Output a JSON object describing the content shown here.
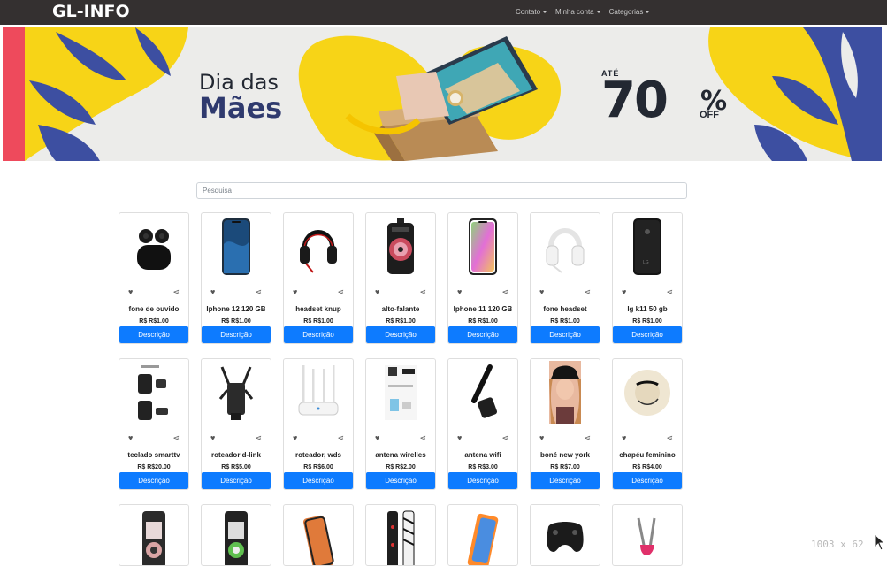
{
  "navbar": {
    "brand": "GL-INFO",
    "menu": [
      {
        "label": "Contato"
      },
      {
        "label": "Minha conta"
      },
      {
        "label": "Categorias"
      }
    ]
  },
  "banner": {
    "title_line1": "Dia das",
    "title_line2": "Mães",
    "ate": "ATÉ",
    "percent": "70",
    "percent_sign": "%",
    "off": "OFF",
    "colors": {
      "yellow": "#f7d417",
      "blue": "#3d4fa1",
      "stripe": "#ee4a5c"
    }
  },
  "search": {
    "placeholder": "Pesquisa",
    "value": ""
  },
  "products": [
    {
      "name": "fone de ouvido",
      "price": "R$ R$1.00",
      "button": "Descrição",
      "icon": "earbuds-icon"
    },
    {
      "name": "Iphone 12 120 GB",
      "price": "R$ R$1.00",
      "button": "Descrição",
      "icon": "iphone-12-icon"
    },
    {
      "name": "headset knup",
      "price": "R$ R$1.00",
      "button": "Descrição",
      "icon": "headset-knup-icon"
    },
    {
      "name": "alto-falante",
      "price": "R$ R$1.00",
      "button": "Descrição",
      "icon": "speaker-icon"
    },
    {
      "name": "Iphone 11 120 GB",
      "price": "R$ R$1.00",
      "button": "Descrição",
      "icon": "iphone-11-icon"
    },
    {
      "name": "fone headset",
      "price": "R$ R$1.00",
      "button": "Descrição",
      "icon": "white-headset-icon"
    },
    {
      "name": "lg k11 50 gb",
      "price": "R$ R$1.00",
      "button": "Descrição",
      "icon": "lg-phone-icon"
    },
    {
      "name": "teclado smarttv",
      "price": "R$ R$20.00",
      "button": "Descrição",
      "icon": "remote-keyboard-icon"
    },
    {
      "name": "roteador d-link",
      "price": "R$ R$5.00",
      "button": "Descrição",
      "icon": "router-dlink-icon"
    },
    {
      "name": "roteador, wds",
      "price": "R$ R$6.00",
      "button": "Descrição",
      "icon": "router-wds-icon"
    },
    {
      "name": "antena wirelles",
      "price": "R$ R$2.00",
      "button": "Descrição",
      "icon": "wireless-adapter-icon"
    },
    {
      "name": "antena wifi",
      "price": "R$ R$3.00",
      "button": "Descrição",
      "icon": "wifi-antenna-icon"
    },
    {
      "name": "boné new york",
      "price": "R$ R$7.00",
      "button": "Descrição",
      "icon": "cap-photo-icon"
    },
    {
      "name": "chapéu feminino",
      "price": "R$ R$4.00",
      "button": "Descrição",
      "icon": "straw-hat-icon"
    }
  ],
  "partial_row": [
    {
      "icon": "phone-case-icon"
    },
    {
      "icon": "phone-case-green-icon"
    },
    {
      "icon": "screen-protector-icon"
    },
    {
      "icon": "patterned-case-icon"
    },
    {
      "icon": "tempered-glass-icon"
    },
    {
      "icon": "gamepad-icon"
    },
    {
      "icon": "pink-accessory-icon"
    }
  ],
  "screen_size_readout": "1003 x 62"
}
